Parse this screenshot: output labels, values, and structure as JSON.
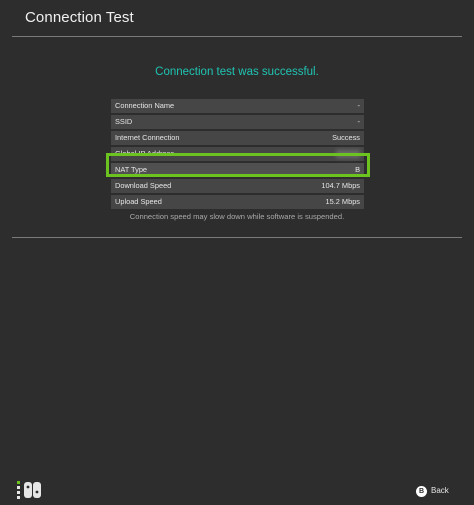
{
  "header": {
    "title": "Connection Test"
  },
  "result": {
    "message": "Connection test was successful."
  },
  "info_rows": [
    {
      "label": "Connection Name",
      "value": "-"
    },
    {
      "label": "SSID",
      "value": "-"
    },
    {
      "label": "Internet Connection",
      "value": "Success"
    },
    {
      "label": "Global IP Address",
      "value": ""
    },
    {
      "label": "NAT Type",
      "value": "B"
    },
    {
      "label": "Download Speed",
      "value": "104.7 Mbps"
    },
    {
      "label": "Upload Speed",
      "value": "15.2 Mbps"
    }
  ],
  "footnote": "Connection speed may slow down while software is suspended.",
  "footer": {
    "back_button_glyph": "B",
    "back_label": "Back",
    "controller_icon": "joycon-controller-icon"
  },
  "colors": {
    "background": "#2d2d2d",
    "success_text": "#1fc4b3",
    "highlight": "#6cc21f",
    "row_bg": "#464646"
  }
}
